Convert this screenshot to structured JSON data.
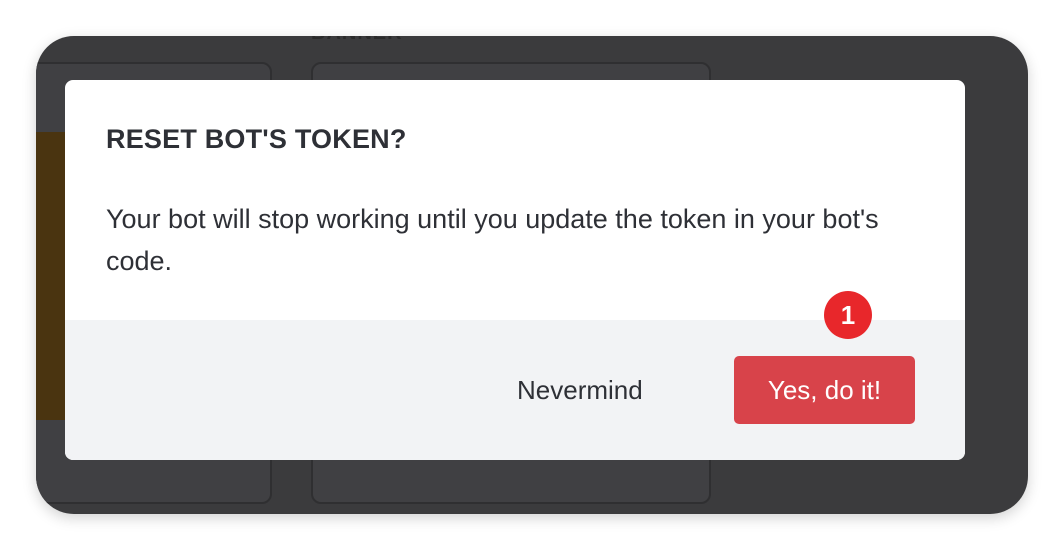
{
  "background": {
    "section_label": "BANNER"
  },
  "modal": {
    "title": "RESET BOT'S TOKEN?",
    "body": "Your bot will stop working until you update the token in your bot's code.",
    "cancel_label": "Nevermind",
    "confirm_label": "Yes, do it!"
  },
  "annotation": {
    "step_number": "1"
  },
  "colors": {
    "confirm_button": "#d8434a",
    "step_badge": "#e8272b",
    "footer_background": "#f2f3f5",
    "backdrop": "#3b3b3d"
  }
}
